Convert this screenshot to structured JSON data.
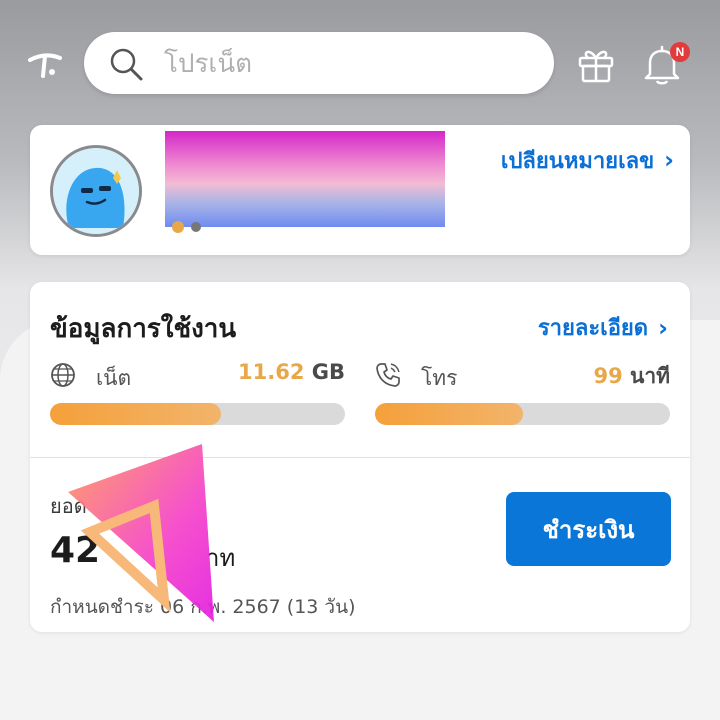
{
  "header": {
    "logo_icon": "dtac-logo-icon",
    "search_placeholder": "โปรเน็ต",
    "gift_icon": "gift-icon",
    "bell_icon": "bell-icon",
    "notification_badge": "N"
  },
  "profile": {
    "avatar_icon": "mascot-avatar-icon",
    "change_number_label": "เปลียนหมายเลข"
  },
  "usage": {
    "title": "ข้อมูลการใช้งาน",
    "details_label": "รายละเอียด",
    "data": {
      "label": "เน็ต",
      "value": "11.62",
      "unit": "GB",
      "progress": 0.58
    },
    "call": {
      "label": "โทร",
      "value": "99",
      "unit": "นาที",
      "progress": 0.5
    }
  },
  "billing": {
    "label": "ยอด",
    "amount": "42",
    "amount_unit": "าท",
    "due_text": "กำหนดชำระ 06 ก.พ. 2567 (13 วัน)",
    "pay_button_label": "ชำระเงิน"
  },
  "colors": {
    "accent_blue": "#0a77d8",
    "progress_orange": "#f5a03a",
    "value_orange": "#e8a84a",
    "badge_red": "#e23b3b"
  }
}
